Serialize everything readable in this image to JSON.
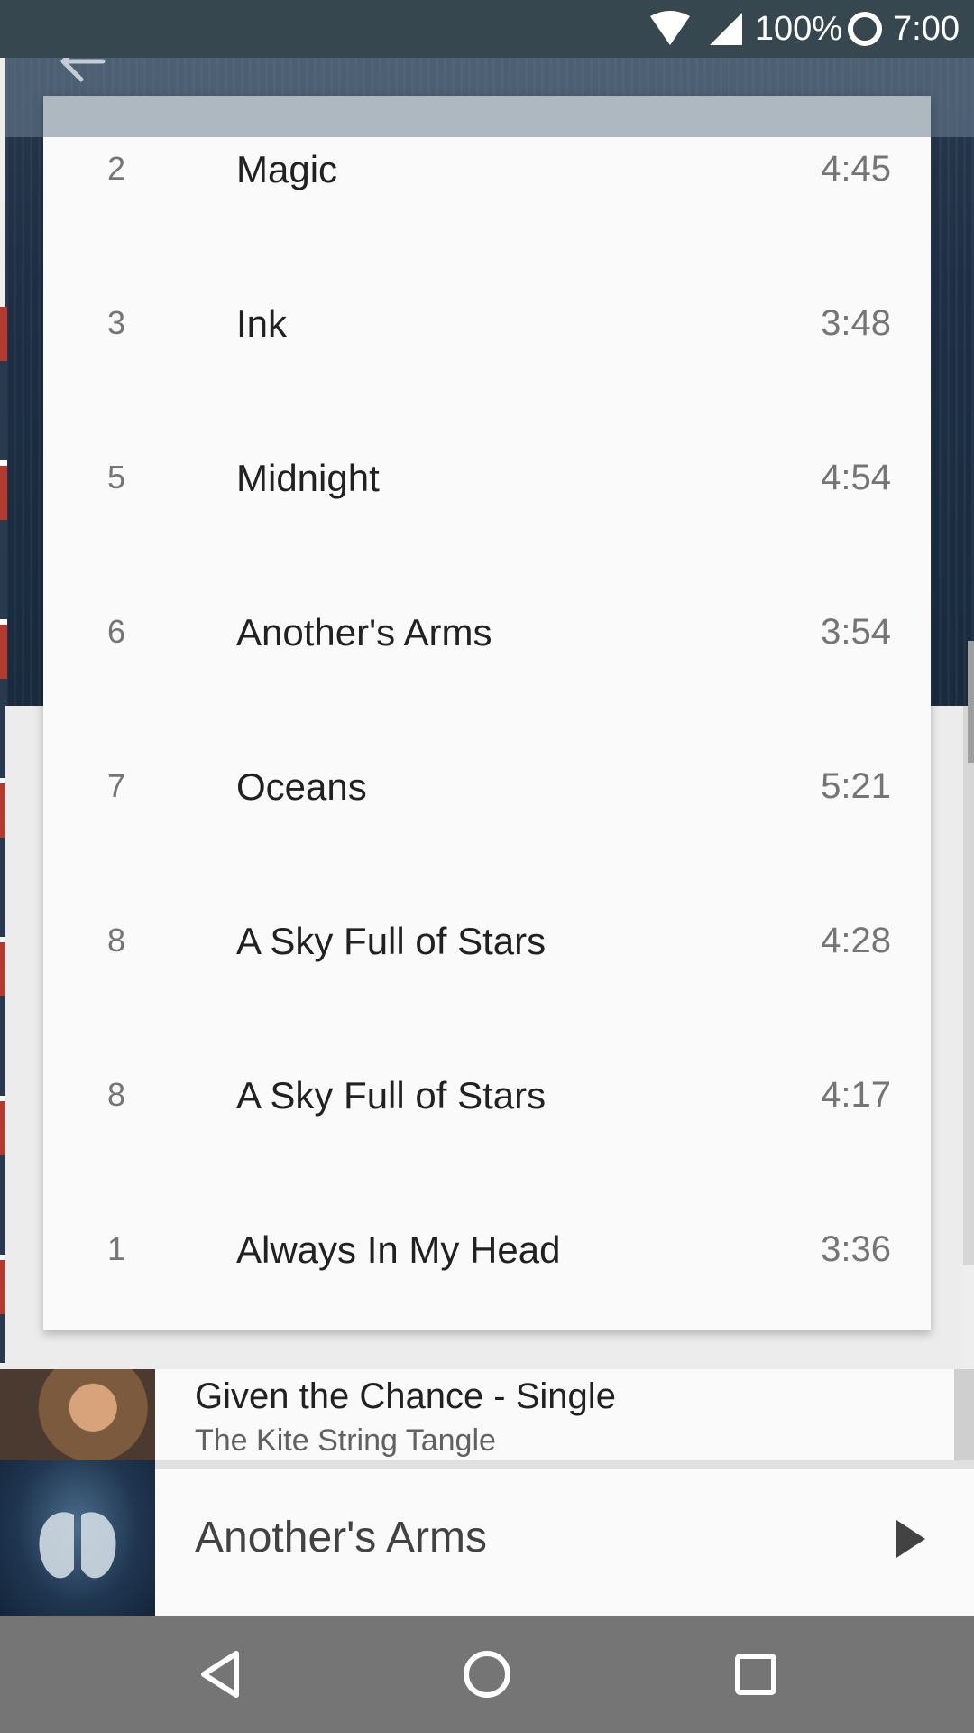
{
  "status_bar": {
    "battery": "100%",
    "time": "7:00",
    "icons": [
      "wifi-icon",
      "cell-signal-icon",
      "battery-ring-icon"
    ]
  },
  "app_bar": {
    "icons": [
      "back-arrow-icon"
    ]
  },
  "tracks": [
    {
      "number": "2",
      "title": "Magic",
      "duration": "4:45"
    },
    {
      "number": "3",
      "title": "Ink",
      "duration": "3:48"
    },
    {
      "number": "5",
      "title": "Midnight",
      "duration": "4:54"
    },
    {
      "number": "6",
      "title": "Another's Arms",
      "duration": "3:54"
    },
    {
      "number": "7",
      "title": "Oceans",
      "duration": "5:21"
    },
    {
      "number": "8",
      "title": "A Sky Full of Stars",
      "duration": "4:28"
    },
    {
      "number": "8",
      "title": "A Sky Full of Stars",
      "duration": "4:17"
    },
    {
      "number": "1",
      "title": "Always In My Head",
      "duration": "3:36"
    }
  ],
  "album_card": {
    "title": "Given the Chance - Single",
    "artist": "The Kite String Tangle"
  },
  "now_playing": {
    "title": "Another's Arms",
    "icons": [
      "play-icon"
    ]
  },
  "nav_bar": {
    "icons": [
      "nav-back-icon",
      "nav-home-icon",
      "nav-recents-icon"
    ]
  },
  "colors": {
    "status_bar": "#37474f",
    "dialog_header": "#aeb8c1",
    "nav_bar": "#757575"
  }
}
